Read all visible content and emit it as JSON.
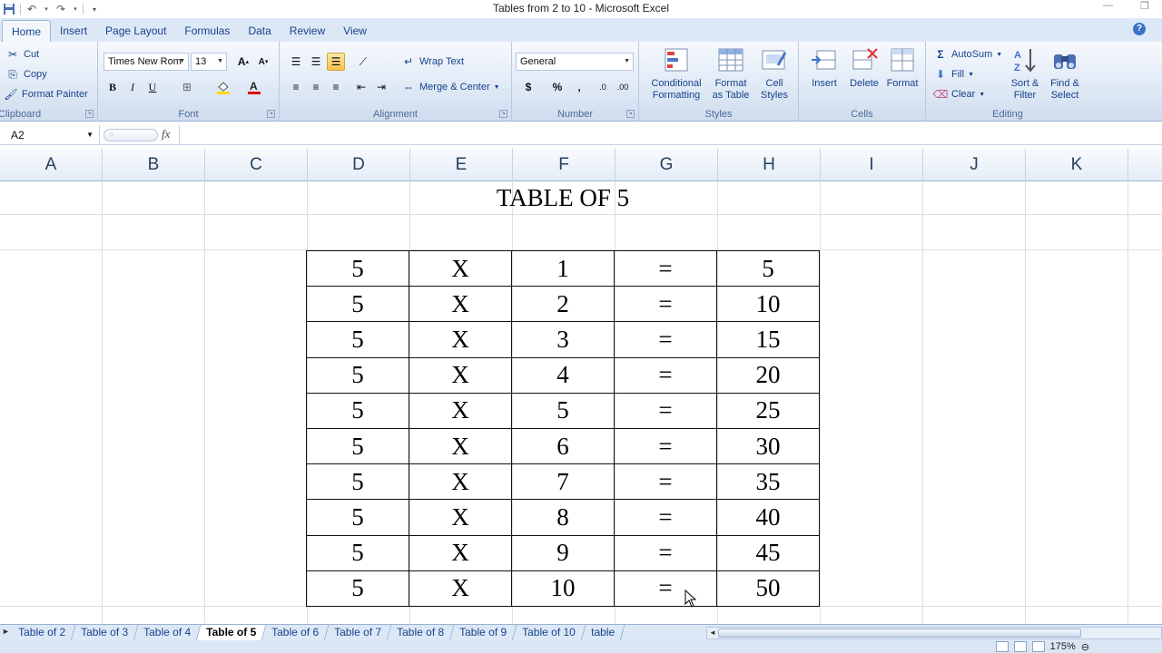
{
  "window": {
    "title": "Tables from 2 to 10 - Microsoft Excel"
  },
  "ribbon_tabs": [
    "Home",
    "Insert",
    "Page Layout",
    "Formulas",
    "Data",
    "Review",
    "View"
  ],
  "clipboard": {
    "cut": "Cut",
    "copy": "Copy",
    "format_painter": "Format Painter",
    "label": "Clipboard"
  },
  "font": {
    "name": "Times New Rom",
    "size": "13",
    "label": "Font",
    "bold": "B",
    "italic": "I",
    "underline": "U",
    "grow": "A",
    "shrink": "A"
  },
  "alignment": {
    "wrap_text": "Wrap Text",
    "merge_center": "Merge & Center",
    "label": "Alignment"
  },
  "number": {
    "format": "General",
    "currency": "$",
    "percent": "%",
    "comma": ",",
    "label": "Number"
  },
  "styles": {
    "conditional_formatting": [
      "Conditional",
      "Formatting"
    ],
    "format_as_table": [
      "Format",
      "as Table"
    ],
    "cell_styles": [
      "Cell",
      "Styles"
    ],
    "label": "Styles"
  },
  "cells": {
    "insert": "Insert",
    "delete": "Delete",
    "format": "Format",
    "label": "Cells"
  },
  "editing": {
    "autosum": "AutoSum",
    "fill": "Fill",
    "clear": "Clear",
    "sort_filter": [
      "Sort &",
      "Filter"
    ],
    "find_select": [
      "Find &",
      "Select"
    ],
    "label": "Editing"
  },
  "formula_bar": {
    "name_box": "A2",
    "fx": "fx",
    "formula": ""
  },
  "columns": [
    "A",
    "B",
    "C",
    "D",
    "E",
    "F",
    "G",
    "H",
    "I",
    "J",
    "K"
  ],
  "sheet": {
    "title": "TABLE OF 5",
    "rows": [
      [
        "5",
        "X",
        "1",
        "=",
        "5"
      ],
      [
        "5",
        "X",
        "2",
        "=",
        "10"
      ],
      [
        "5",
        "X",
        "3",
        "=",
        "15"
      ],
      [
        "5",
        "X",
        "4",
        "=",
        "20"
      ],
      [
        "5",
        "X",
        "5",
        "=",
        "25"
      ],
      [
        "5",
        "X",
        "6",
        "=",
        "30"
      ],
      [
        "5",
        "X",
        "7",
        "=",
        "35"
      ],
      [
        "5",
        "X",
        "8",
        "=",
        "40"
      ],
      [
        "5",
        "X",
        "9",
        "=",
        "45"
      ],
      [
        "5",
        "X",
        "10",
        "=",
        "50"
      ]
    ]
  },
  "sheet_tabs": {
    "items": [
      "Table of 2",
      "Table of 3",
      "Table of 4",
      "Table of 5",
      "Table of 6",
      "Table of 7",
      "Table of 8",
      "Table of 9",
      "Table of 10",
      "table"
    ],
    "active": "Table of 5"
  },
  "status": {
    "zoom": "175%"
  },
  "colors": {
    "ribbon_blue": "#dde8f6",
    "text_blue": "#15428b",
    "active_highlight": "#f7c24e"
  }
}
